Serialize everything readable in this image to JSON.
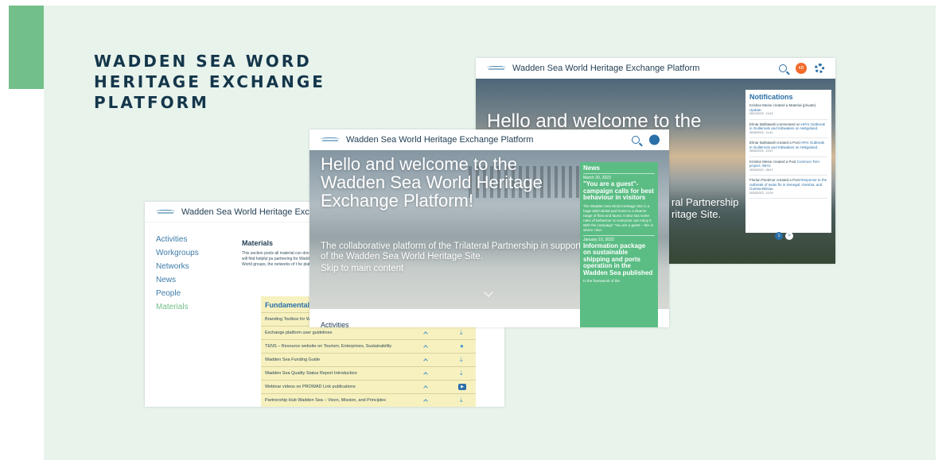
{
  "heading": "WADDEN SEA WORD HERITAGE EXCHANGE PLATFORM",
  "platform_name": "Wadden Sea World Heritage Exchange Platform",
  "colors": {
    "accent": "#73bf8a",
    "panel_bg": "#e8f3ec",
    "heading": "#14364a",
    "news_green": "#5bbd84",
    "table_yellow": "#f6f1bf"
  },
  "back_shot": {
    "hero_title": "Hello and welcome to the",
    "hero_lines": [
      "ral Partnership",
      "ritage Site."
    ],
    "avatar_text": "KB",
    "notifications": {
      "title": "Notifications",
      "items": [
        {
          "text": "Kristine Meise created a Material (private)",
          "link": "Update.",
          "time": "06/13/2023 - 14:49"
        },
        {
          "text": "Elmar Ballstaedt commented on",
          "link": "HPAI Outbreak in Guillemots and Kittiwakes on Heligoland.",
          "time": "06/06/2023 - 11:44"
        },
        {
          "text": "Elmar Ballstaedt created a Post",
          "link": "HPAI Outbreak in Guillemots and Kittiwakes on Heligoland.",
          "time": "06/06/2023 - 10:57"
        },
        {
          "text": "Kristine Meise created a Post",
          "link": "Common Tern project, WHV.",
          "time": "06/06/2023 - 08:47"
        },
        {
          "text": "Florian Packmor created a Post",
          "link": "Response to the outbreak of avian flu in Senegal, Gambia, and Guinea-Bissau.",
          "time": "05/26/2023 - 10:29"
        }
      ],
      "pager_current": "1",
      "pager_next": ">"
    }
  },
  "left_shot": {
    "nav": [
      "Activities",
      "Workgroups",
      "Networks",
      "News",
      "People",
      "Materials"
    ],
    "materials_title": "Materials",
    "materials_text": "This section pools all material con documents you will find helpful pu partnering for Wadden Sea World groups, the networks of t he platf listed.",
    "fundamental_title": "Fundamental docume",
    "rows": [
      {
        "label": "Branding Toolbox for Wadden Se",
        "icon": "download-icon"
      },
      {
        "label": "Exchange platform user guidelines",
        "icon": "download-icon"
      },
      {
        "label": "TENS – Resource website on Tourism, Enterprises, Sustainability",
        "icon": "globe-icon"
      },
      {
        "label": "Wadden Sea Funding Guide",
        "icon": "download-icon"
      },
      {
        "label": "Wadden Sea Quality Status Report Introduction",
        "icon": "download-icon"
      },
      {
        "label": "Webinar videos on PROWAD Link publications",
        "icon": "video-icon"
      },
      {
        "label": "Partnership Hub Wadden Sea – Vison, Mission, and Principles",
        "icon": "download-icon"
      }
    ]
  },
  "front_shot": {
    "hero_title": "Hello and welcome to the Wadden Sea World Heritage Exchange Platform!",
    "hero_sub": "The collaborative platform of the Trilateral Partnership in support of the Wadden Sea World Heritage Site.",
    "skip_link": "Skip to main content",
    "bottom_label": "Activities",
    "news": {
      "title": "News",
      "items": [
        {
          "date": "March 20, 2023",
          "headline": "\"You are a guest\"-campaign calls for best behaviour in visitors",
          "body": "The Wadden Sea World Heritage Site is a huge wild habitat and home to a diverse range of flora and fauna. It also has some rules of behaviour so everyone can enjoy it. With the campaign \"You are a guest – this is where I live."
        },
        {
          "date": "January 10, 2023",
          "headline": "Information package on sustainable shipping and ports operation in the Wadden Sea published",
          "body": "In the framework of the"
        }
      ]
    }
  }
}
